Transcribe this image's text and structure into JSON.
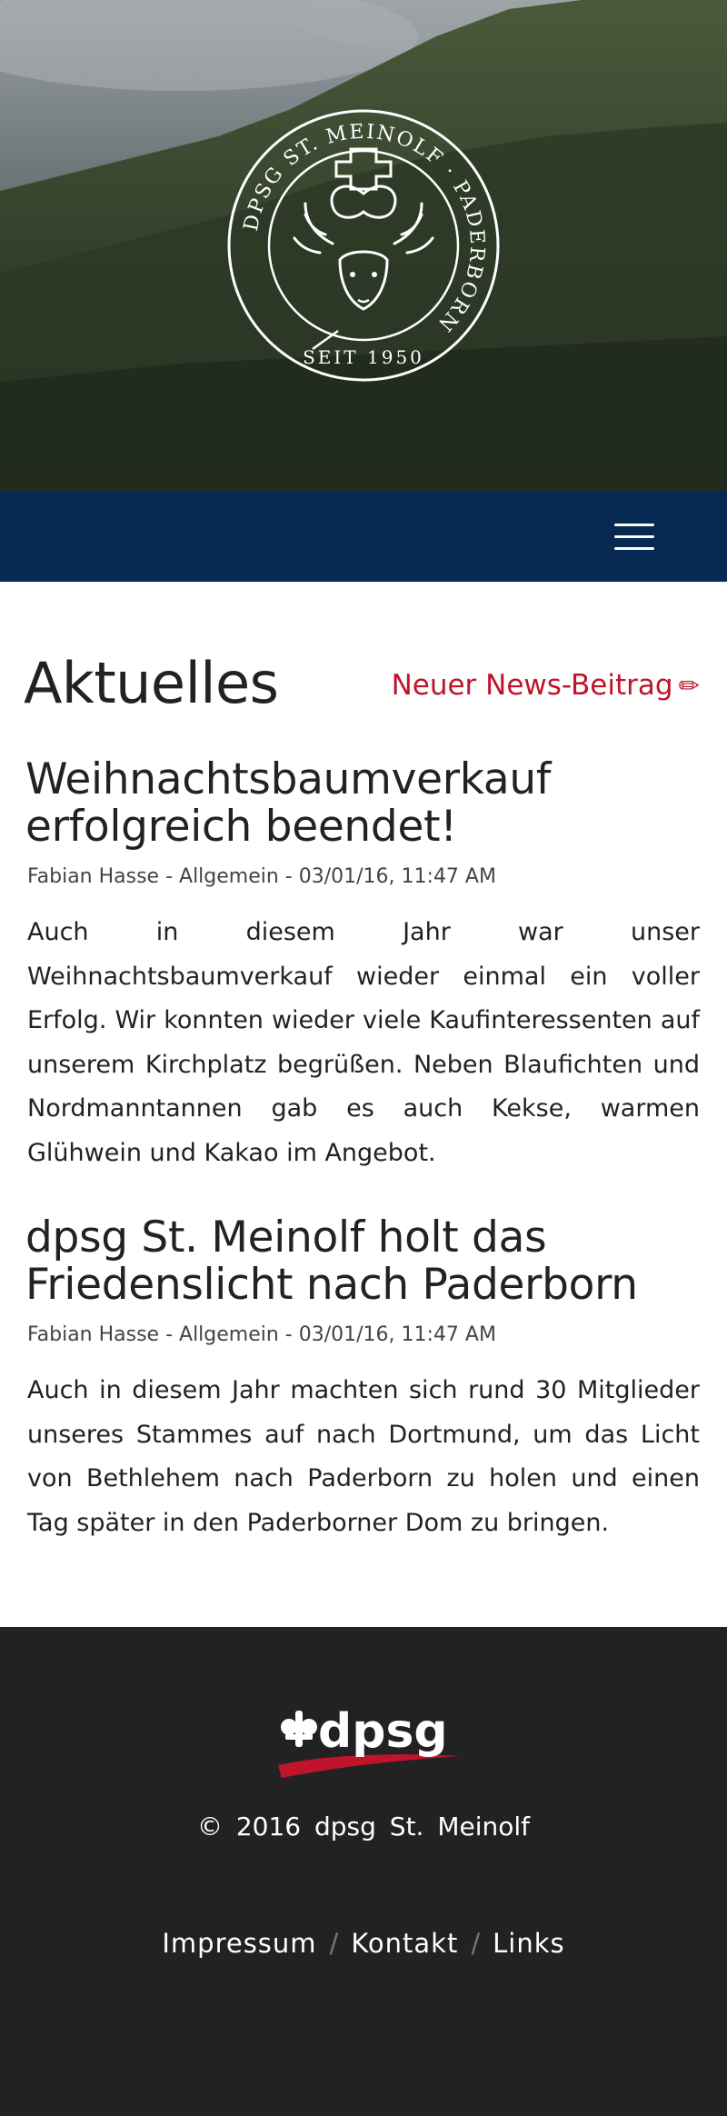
{
  "header": {
    "logo_icon": "scout-stag-seal-icon",
    "logo_ring_text": "DPSG ST. MEINOLF · PADERBORN",
    "logo_since": "SEIT 1950",
    "menu_icon": "hamburger-menu-icon",
    "navbar_color": "#062a52"
  },
  "main": {
    "title": "Aktuelles",
    "new_post_label": "Neuer News-Beitrag",
    "new_post_icon": "pencil-icon",
    "new_post_glyph": "✏",
    "accent_color": "#c0142a",
    "posts": [
      {
        "title_line1": "Weihnachtsbaumverkauf",
        "title_line2": "erfolgreich beendet!",
        "meta": "Fabian Hasse - Allgemein - 03/01/16, 11:47 AM",
        "body": "Auch in diesem Jahr war unser Weihnachtsbaumverkauf wieder einmal ein voller Erfolg. Wir konnten wieder viele Kaufinteressenten auf unserem Kirchplatz begrüßen. Neben Blaufichten und Nordmanntannen gab es auch Kekse, warmen Glühwein und Kakao im Angebot."
      },
      {
        "title_line1": "dpsg St. Meinolf holt das",
        "title_line2": "Friedenslicht nach Paderborn",
        "meta": "Fabian Hasse - Allgemein - 03/01/16, 11:47 AM",
        "body": "Auch in diesem Jahr machten sich rund 30 Mitglieder unseres Stammes auf nach Dortmund, um das Licht von Bethlehem nach Paderborn zu holen und einen Tag später in den Paderborner Dom zu bringen."
      }
    ]
  },
  "footer": {
    "logo_text": "dpsg",
    "logo_icon": "dpsg-lily-logo-icon",
    "copyright": "© 2016 dpsg St. Meinolf",
    "links": [
      "Impressum",
      "Kontakt",
      "Links"
    ],
    "separator": "/",
    "background": "#222222"
  }
}
